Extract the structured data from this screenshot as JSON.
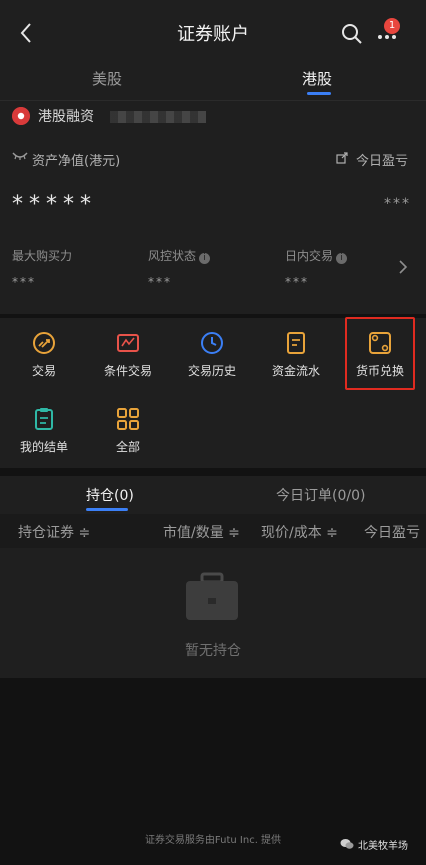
{
  "header": {
    "title": "证券账户",
    "badge_count": "1"
  },
  "market_tabs": [
    {
      "label": "美股",
      "active": false
    },
    {
      "label": "港股",
      "active": true
    }
  ],
  "account": {
    "label": "港股融资"
  },
  "asset": {
    "net_label": "资产净值(港元)",
    "net_value": "*****",
    "today_pl_label": "今日盈亏",
    "today_pl_value": "***"
  },
  "stats": [
    {
      "label": "最大购买力",
      "value": "***"
    },
    {
      "label": "风控状态",
      "value": "***"
    },
    {
      "label": "日内交易",
      "value": "***"
    }
  ],
  "functions": [
    {
      "label": "交易",
      "icon": "trade-icon",
      "color": "#e8a33a"
    },
    {
      "label": "条件交易",
      "icon": "condition-trade-icon",
      "color": "#e8534a"
    },
    {
      "label": "交易历史",
      "icon": "history-clock-icon",
      "color": "#3b7ff5"
    },
    {
      "label": "资金流水",
      "icon": "cash-flow-doc-icon",
      "color": "#e8a33a"
    },
    {
      "label": "货币兑换",
      "icon": "currency-exchange-icon",
      "color": "#e8a33a"
    },
    {
      "label": "我的结单",
      "icon": "statement-clipboard-icon",
      "color": "#2fb8a6"
    },
    {
      "label": "全部",
      "icon": "all-grid-icon",
      "color": "#e8a33a"
    }
  ],
  "holdings_tabs": [
    {
      "label": "持仓(0)",
      "active": true
    },
    {
      "label": "今日订单(0/0)",
      "active": false
    }
  ],
  "columns": [
    "持仓证券 ≑",
    "市值/数量 ≑",
    "现价/成本 ≑",
    "今日盈亏"
  ],
  "empty_text": "暂无持仓",
  "footer": "证券交易服务由Futu Inc. 提供",
  "watermark": "北美牧羊场"
}
